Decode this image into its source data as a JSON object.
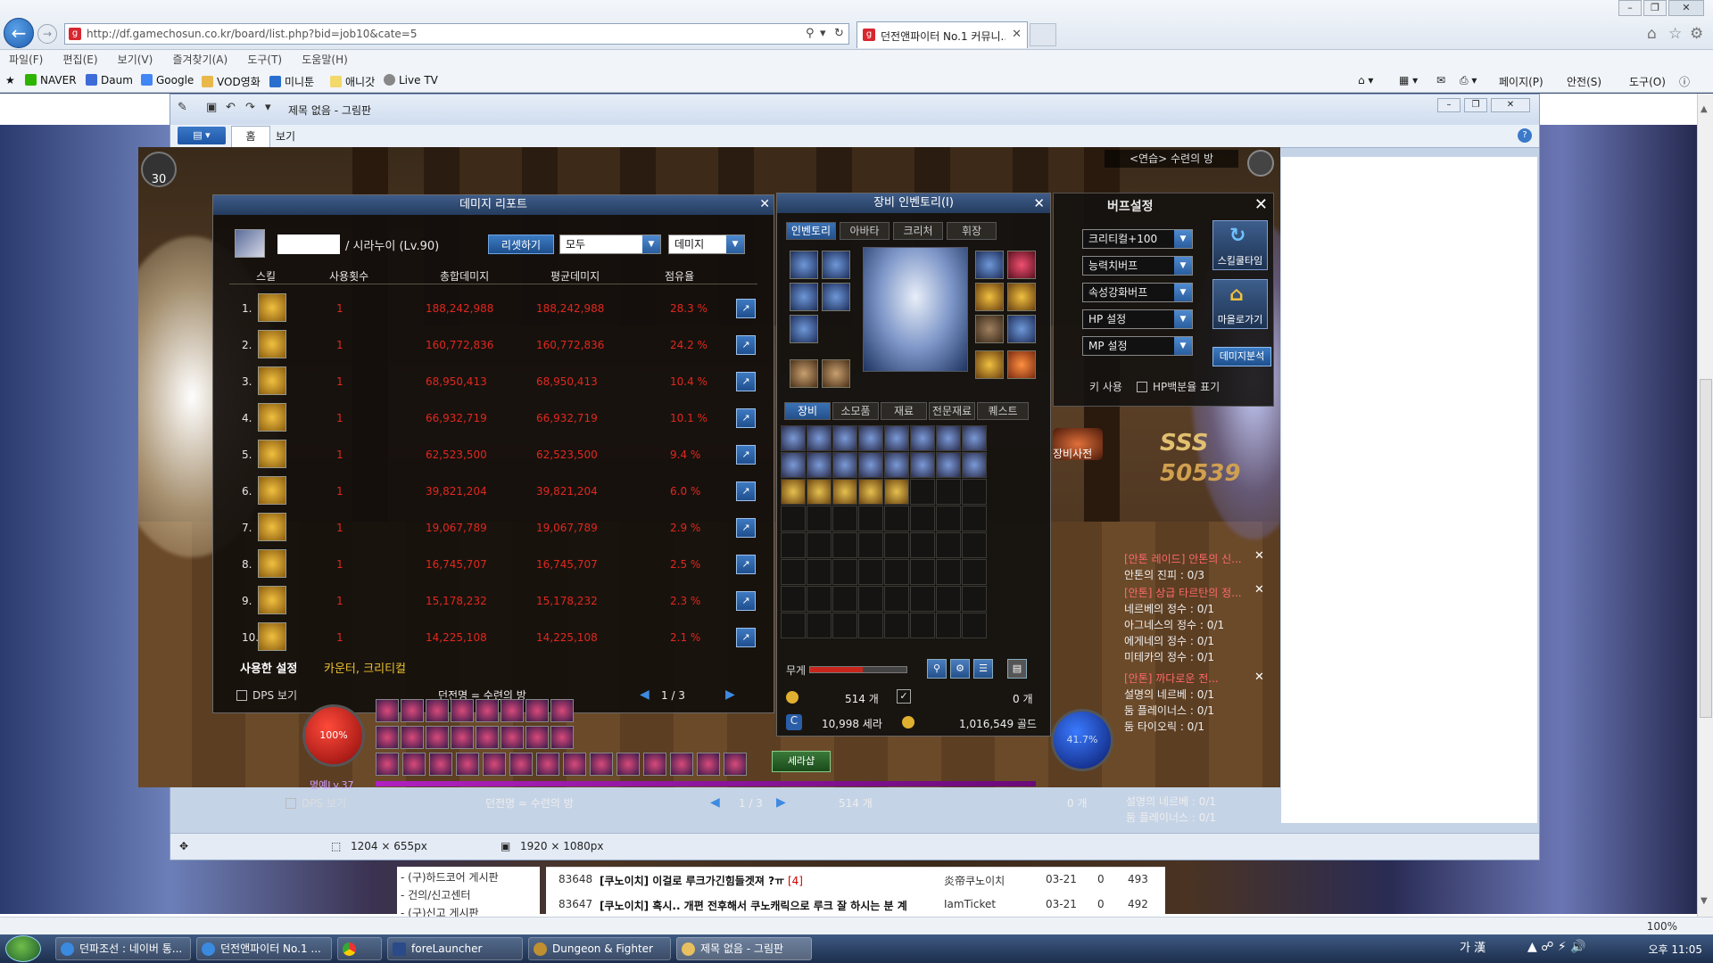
{
  "browser": {
    "url": "http://df.gamechosun.co.kr/board/list.php?bid=job10&cate=5",
    "tab_title": "던전앤파이터 No.1 커뮤니...",
    "menu": [
      "파일(F)",
      "편집(E)",
      "보기(V)",
      "즐겨찾기(A)",
      "도구(T)",
      "도움말(H)"
    ],
    "favorites": [
      "NAVER",
      "Daum",
      "Google",
      "VOD영화",
      "미니툰",
      "애니갓",
      "Live TV"
    ],
    "commands": [
      "페이지(P)",
      "안전(S)",
      "도구(O)"
    ],
    "zoom": "100%"
  },
  "paint": {
    "title": "제목 없음 - 그림판",
    "tabs": [
      "홈",
      "보기"
    ],
    "status_selection": "1204 × 655px",
    "status_size": "1920 × 1080px"
  },
  "damage_report": {
    "title": "데미지 리포트",
    "character": "/ 시라누이 (Lv.90)",
    "reset_label": "리셋하기",
    "filter1": "모두",
    "filter2": "데미지",
    "headers": [
      "스킬",
      "사용횟수",
      "총합데미지",
      "평균데미지",
      "점유율"
    ],
    "rows": [
      {
        "rank": "1.",
        "count": "1",
        "total": "188,242,988",
        "avg": "188,242,988",
        "share": "28.3 %"
      },
      {
        "rank": "2.",
        "count": "1",
        "total": "160,772,836",
        "avg": "160,772,836",
        "share": "24.2 %"
      },
      {
        "rank": "3.",
        "count": "1",
        "total": "68,950,413",
        "avg": "68,950,413",
        "share": "10.4 %"
      },
      {
        "rank": "4.",
        "count": "1",
        "total": "66,932,719",
        "avg": "66,932,719",
        "share": "10.1 %"
      },
      {
        "rank": "5.",
        "count": "1",
        "total": "62,523,500",
        "avg": "62,523,500",
        "share": "9.4 %"
      },
      {
        "rank": "6.",
        "count": "1",
        "total": "39,821,204",
        "avg": "39,821,204",
        "share": "6.0 %"
      },
      {
        "rank": "7.",
        "count": "1",
        "total": "19,067,789",
        "avg": "19,067,789",
        "share": "2.9 %"
      },
      {
        "rank": "8.",
        "count": "1",
        "total": "16,745,707",
        "avg": "16,745,707",
        "share": "2.5 %"
      },
      {
        "rank": "9.",
        "count": "1",
        "total": "15,178,232",
        "avg": "15,178,232",
        "share": "2.3 %"
      },
      {
        "rank": "10.",
        "count": "1",
        "total": "14,225,108",
        "avg": "14,225,108",
        "share": "2.1 %"
      }
    ],
    "setting_label": "사용한 설정",
    "setting_value": "카운터, 크리티컬",
    "dps_label": "DPS 보기",
    "dungeon": "던전명 = 수련의 방",
    "page": "1 / 3"
  },
  "inventory": {
    "title": "장비 인벤토리(I)",
    "top_tabs": [
      "인벤토리",
      "아바타",
      "크리처",
      "휘장"
    ],
    "bottom_tabs": [
      "장비",
      "소모품",
      "재료",
      "전문재료",
      "퀘스트"
    ],
    "weight_label": "무게",
    "weight_fill": 0.55,
    "stones": "514 개",
    "other": "0 개",
    "cera": "10,998 세라",
    "gold": "1,016,549 골드",
    "dictionary": "장비사전"
  },
  "buff": {
    "title": "버프설정",
    "options": [
      "크리티컬+100",
      "능력치버프",
      "속성강화버프",
      "HP 설정",
      "MP 설정"
    ],
    "skill_cooltime": "스킬쿨타임",
    "go_town": "마을로가기",
    "damage_analysis": "데미지분석",
    "hp_label": "키 사용",
    "hp_percent": "HP백분율 표기"
  },
  "zone": "<연습> 수련의 방",
  "quests": [
    {
      "t": "[안톤 레이드] 안톤의 신...",
      "h": true
    },
    {
      "t": "안톤의 진피 : 0/3",
      "h": false
    },
    {
      "t": "[안톤] 상급 타르탄의 정...",
      "h": true
    },
    {
      "t": "네르베의 정수 : 0/1",
      "h": false
    },
    {
      "t": "아그네스의 정수 : 0/1",
      "h": false
    },
    {
      "t": "에게네의 정수 : 0/1",
      "h": false
    },
    {
      "t": "미테카의 정수 : 0/1",
      "h": false
    },
    {
      "t": "[안톤] 까다로운 전...",
      "h": true
    },
    {
      "t": "설명의 네르베 : 0/1",
      "h": false
    },
    {
      "t": "둠 플레이너스 : 0/1",
      "h": false
    },
    {
      "t": "둠 타이오릭 : 0/1",
      "h": false
    }
  ],
  "combo": {
    "rank": "SSS",
    "score": "50539"
  },
  "hud": {
    "hp": "100%",
    "mp": "41.7%",
    "level": "명예Lv.37",
    "shortcut": "세라샵"
  },
  "hud2": {
    "dps": "DPS 보기",
    "dungeon": "던전명 = 수련의 방",
    "page": "1 / 3",
    "coin": "514 개",
    "zero": "0 개",
    "quest1": "설명의 네르베 : 0/1",
    "quest2": "둠 플레이너스 : 0/1"
  },
  "site": {
    "sidebar": [
      "- (구)하드코어 게시판",
      "- 건의/신고센터",
      "- (구)신고 게시판"
    ],
    "rows": [
      {
        "id": "83648",
        "title": "[쿠노이치] 이걸로 루크가긴힘들겟져 ?ㅠ",
        "comments": "[4]",
        "author": "炎帝쿠노이치",
        "date": "03-21",
        "rec": "0",
        "views": "493"
      },
      {
        "id": "83647",
        "title": "[쿠노이치] 혹시.. 개편 전후해서 쿠노캐릭으로 루크 잘 하시는 분 계",
        "comments": "",
        "author": "IamTicket",
        "date": "03-21",
        "rec": "0",
        "views": "492"
      }
    ]
  },
  "taskbar": {
    "items": [
      "던파조선 : 네이버 통...",
      "던전앤파이터 No.1 ...",
      "",
      "foreLauncher",
      "Dungeon & Fighter",
      "제목 없음 - 그림판"
    ],
    "ime": "가 漢",
    "clock": "오후 11:05"
  }
}
